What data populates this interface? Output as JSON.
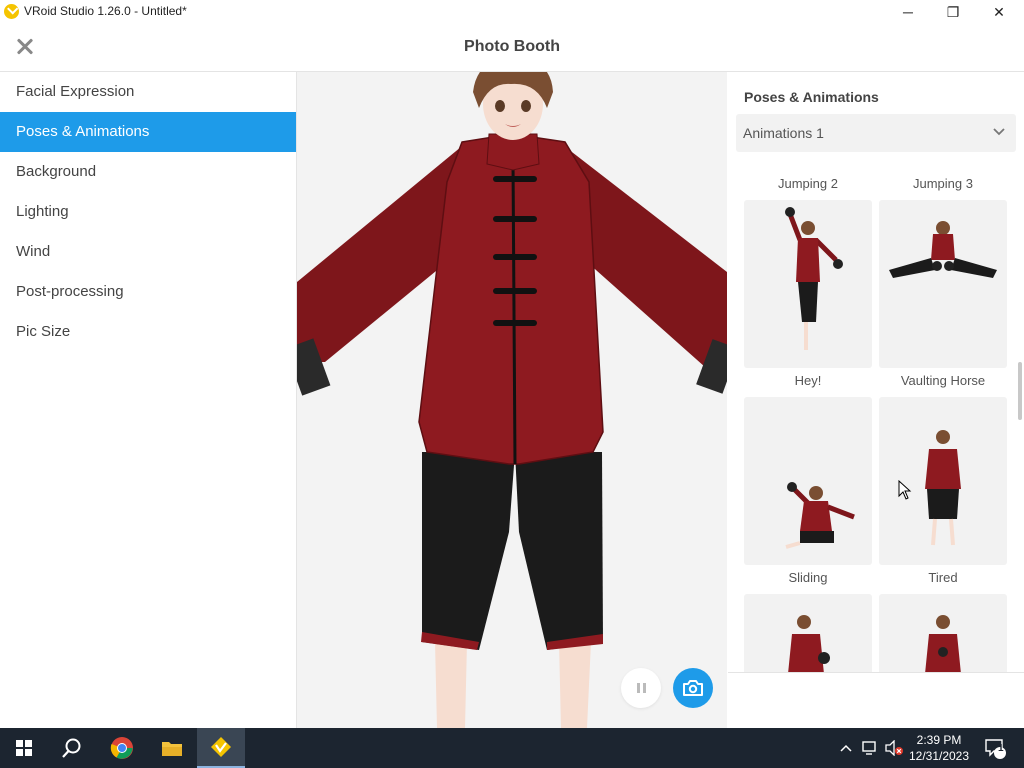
{
  "window": {
    "title": "VRoid Studio 1.26.0 - Untitled*",
    "minimize_glyph": "─",
    "maximize_glyph": "❐",
    "close_glyph": "✕"
  },
  "header": {
    "title": "Photo Booth"
  },
  "sidebar": {
    "items": [
      {
        "label": "Facial Expression",
        "active": false
      },
      {
        "label": "Poses & Animations",
        "active": true
      },
      {
        "label": "Background",
        "active": false
      },
      {
        "label": "Lighting",
        "active": false
      },
      {
        "label": "Wind",
        "active": false
      },
      {
        "label": "Post-processing",
        "active": false
      },
      {
        "label": "Pic Size",
        "active": false
      }
    ]
  },
  "panel": {
    "title": "Poses & Animations",
    "dropdown_value": "Animations 1",
    "animations": [
      {
        "label": "Jumping 2"
      },
      {
        "label": "Jumping 3"
      },
      {
        "label": "Hey!"
      },
      {
        "label": "Vaulting Horse"
      },
      {
        "label": "Sliding"
      },
      {
        "label": "Tired"
      },
      {
        "label": ""
      },
      {
        "label": ""
      }
    ]
  },
  "taskbar": {
    "time": "2:39 PM",
    "date": "12/31/2023",
    "notification_count": "1"
  },
  "colors": {
    "accent": "#1e9be9",
    "jacket": "#8e1a20",
    "pants": "#1b1b1b",
    "taskbar": "#1c2530"
  }
}
